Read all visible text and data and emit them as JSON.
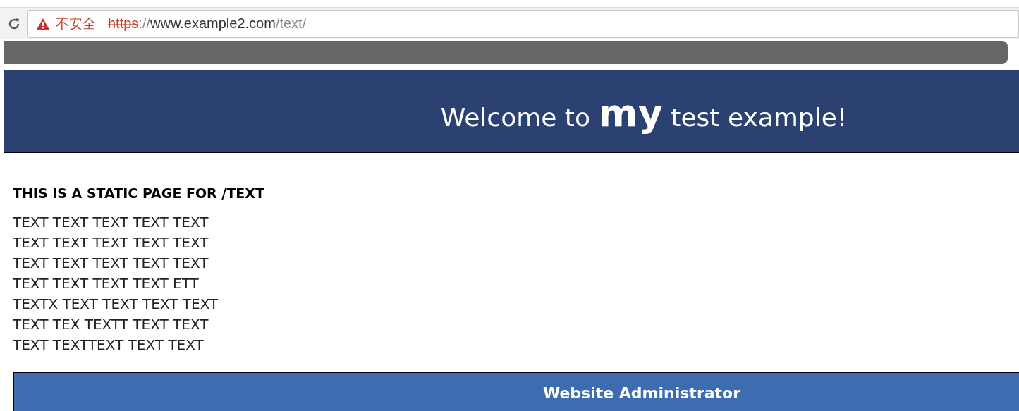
{
  "browser": {
    "security_label": "不安全",
    "url": {
      "scheme": "https",
      "separator": "://",
      "host": "www.example2.com",
      "path": "/text/"
    }
  },
  "banner": {
    "title": "Welcome to **my** test example!"
  },
  "content": {
    "heading": "THIS IS A STATIC PAGE FOR /TEXT",
    "lines": [
      "TEXT TEXT TEXT TEXT TEXT",
      "TEXT TEXT TEXT TEXT TEXT",
      "TEXT TEXT TEXT TEXT TEXT",
      "TEXT TEXT TEXT TEXT ETT",
      "TEXTX TEXT TEXT TEXT TEXT",
      "TEXT TEX TEXTT TEXT TEXT",
      "TEXT TEXTTEXT TEXT TEXT"
    ]
  },
  "footer": {
    "title": "Website Administrator"
  }
}
